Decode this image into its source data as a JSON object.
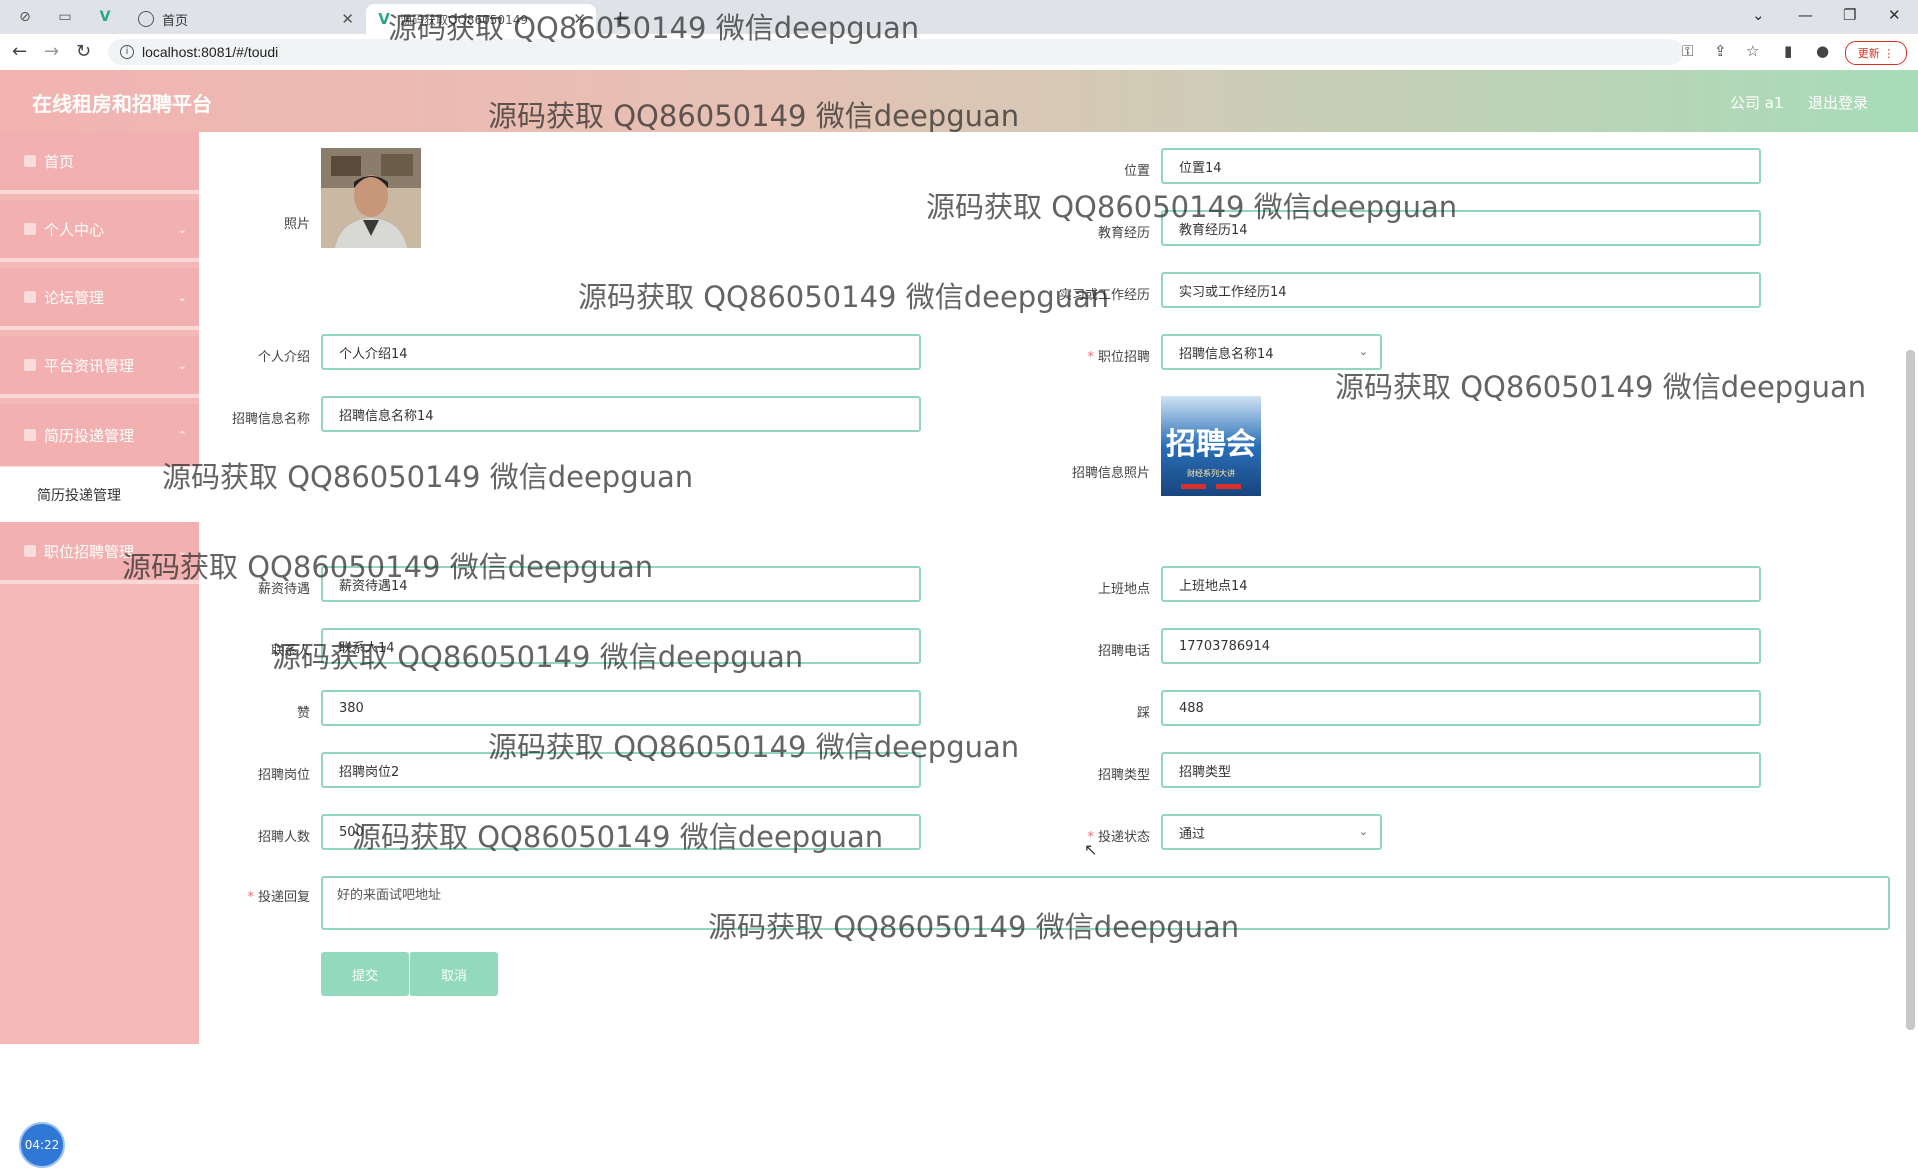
{
  "browser": {
    "tabs": [
      {
        "label": "首页",
        "active": false
      },
      {
        "label": "源码获取QQ86050149",
        "active": true
      }
    ],
    "url": "localhost:8081/#/toudi",
    "update_label": "更新"
  },
  "header": {
    "title": "在线租房和招聘平台",
    "user": "公司 a1",
    "logout": "退出登录"
  },
  "sidebar": {
    "items": [
      {
        "label": "首页"
      },
      {
        "label": "个人中心"
      },
      {
        "label": "论坛管理"
      },
      {
        "label": "平台资讯管理"
      },
      {
        "label": "简历投递管理"
      },
      {
        "label": "职位招聘管理"
      }
    ],
    "active_sub": "简历投递管理"
  },
  "clock": "04:22",
  "form": {
    "photo_label": "照片",
    "position_label": "位置",
    "position_value": "位置14",
    "education_label": "教育经历",
    "education_value": "教育经历14",
    "experience_label": "实习或工作经历",
    "experience_value": "实习或工作经历14",
    "intro_label": "个人介绍",
    "intro_value": "个人介绍14",
    "job_label": "职位招聘",
    "job_value": "招聘信息名称14",
    "recruit_name_label": "招聘信息名称",
    "recruit_name_value": "招聘信息名称14",
    "recruit_photo_label": "招聘信息照片",
    "recruit_photo_text": "招聘会",
    "recruit_photo_sub": "财经系列大讲",
    "salary_label": "薪资待遇",
    "salary_value": "薪资待遇14",
    "workplace_label": "上班地点",
    "workplace_value": "上班地点14",
    "contact_label": "联系人",
    "contact_value": "联系人14",
    "phone_label": "招聘电话",
    "phone_value": "17703786914",
    "likes_label": "赞",
    "likes_value": "380",
    "dislikes_label": "踩",
    "dislikes_value": "488",
    "post_label": "招聘岗位",
    "post_value": "招聘岗位2",
    "type_label": "招聘类型",
    "type_value": "招聘类型",
    "count_label": "招聘人数",
    "count_value": "500",
    "status_label": "投递状态",
    "status_value": "通过",
    "reply_label": "投递回复",
    "reply_value": "好的来面试吧地址",
    "submit_label": "提交",
    "cancel_label": "取消"
  },
  "watermark": "源码获取 QQ86050149 微信deepguan"
}
